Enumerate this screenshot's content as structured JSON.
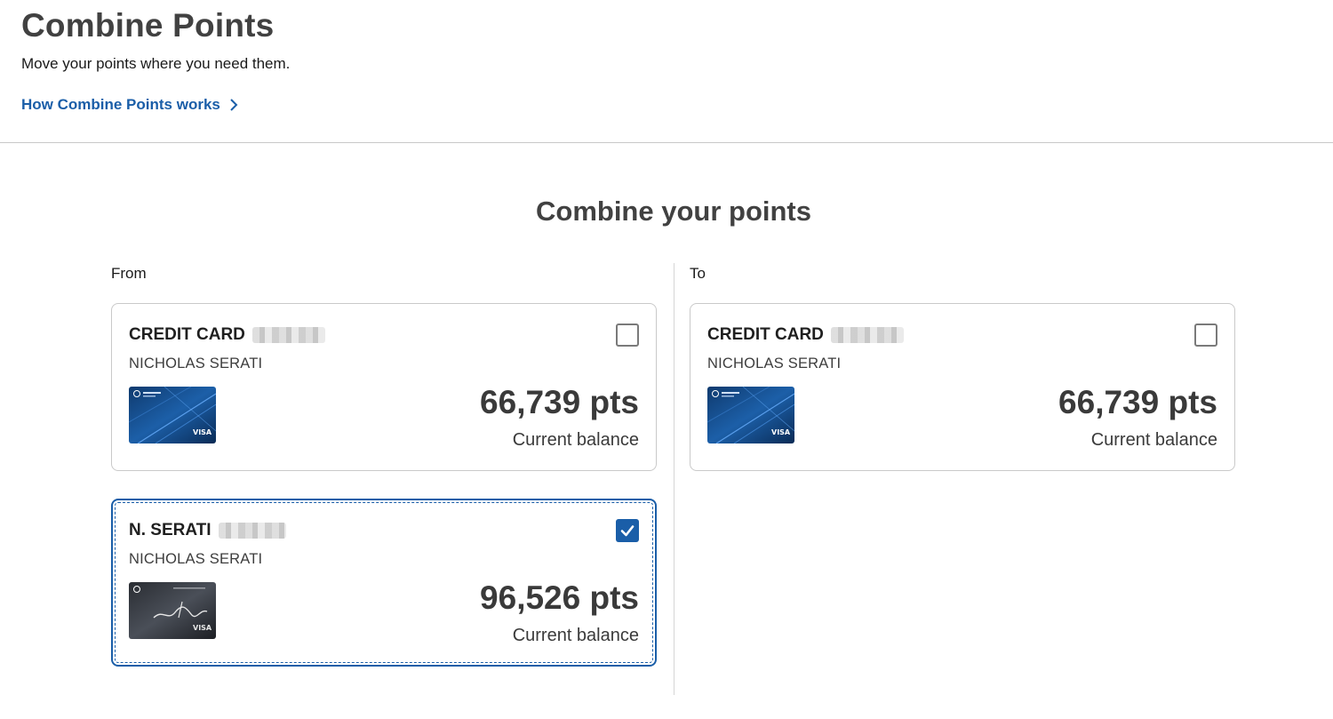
{
  "header": {
    "title": "Combine Points",
    "subtitle": "Move your points where you need them.",
    "how_link": "How Combine Points works"
  },
  "main": {
    "section_title": "Combine your points",
    "from_label": "From",
    "to_label": "To",
    "from_cards": [
      {
        "name": "CREDIT CARD",
        "holder": "NICHOLAS SERATI",
        "points": "66,739 pts",
        "balance_label": "Current balance",
        "selected": false,
        "card_art": "sapphire-preferred-card"
      },
      {
        "name": "N. SERATI",
        "holder": "NICHOLAS SERATI",
        "points": "96,526 pts",
        "balance_label": "Current balance",
        "selected": true,
        "card_art": "ink-business-card"
      }
    ],
    "to_cards": [
      {
        "name": "CREDIT CARD",
        "holder": "NICHOLAS SERATI",
        "points": "66,739 pts",
        "balance_label": "Current balance",
        "selected": false,
        "card_art": "sapphire-preferred-card"
      }
    ]
  },
  "colors": {
    "accent": "#1a5ea8",
    "text": "#3d3d3d",
    "border": "#c9c9c9"
  },
  "icons": {
    "link_arrow": "chevron-right-icon",
    "check": "checkmark-icon"
  }
}
